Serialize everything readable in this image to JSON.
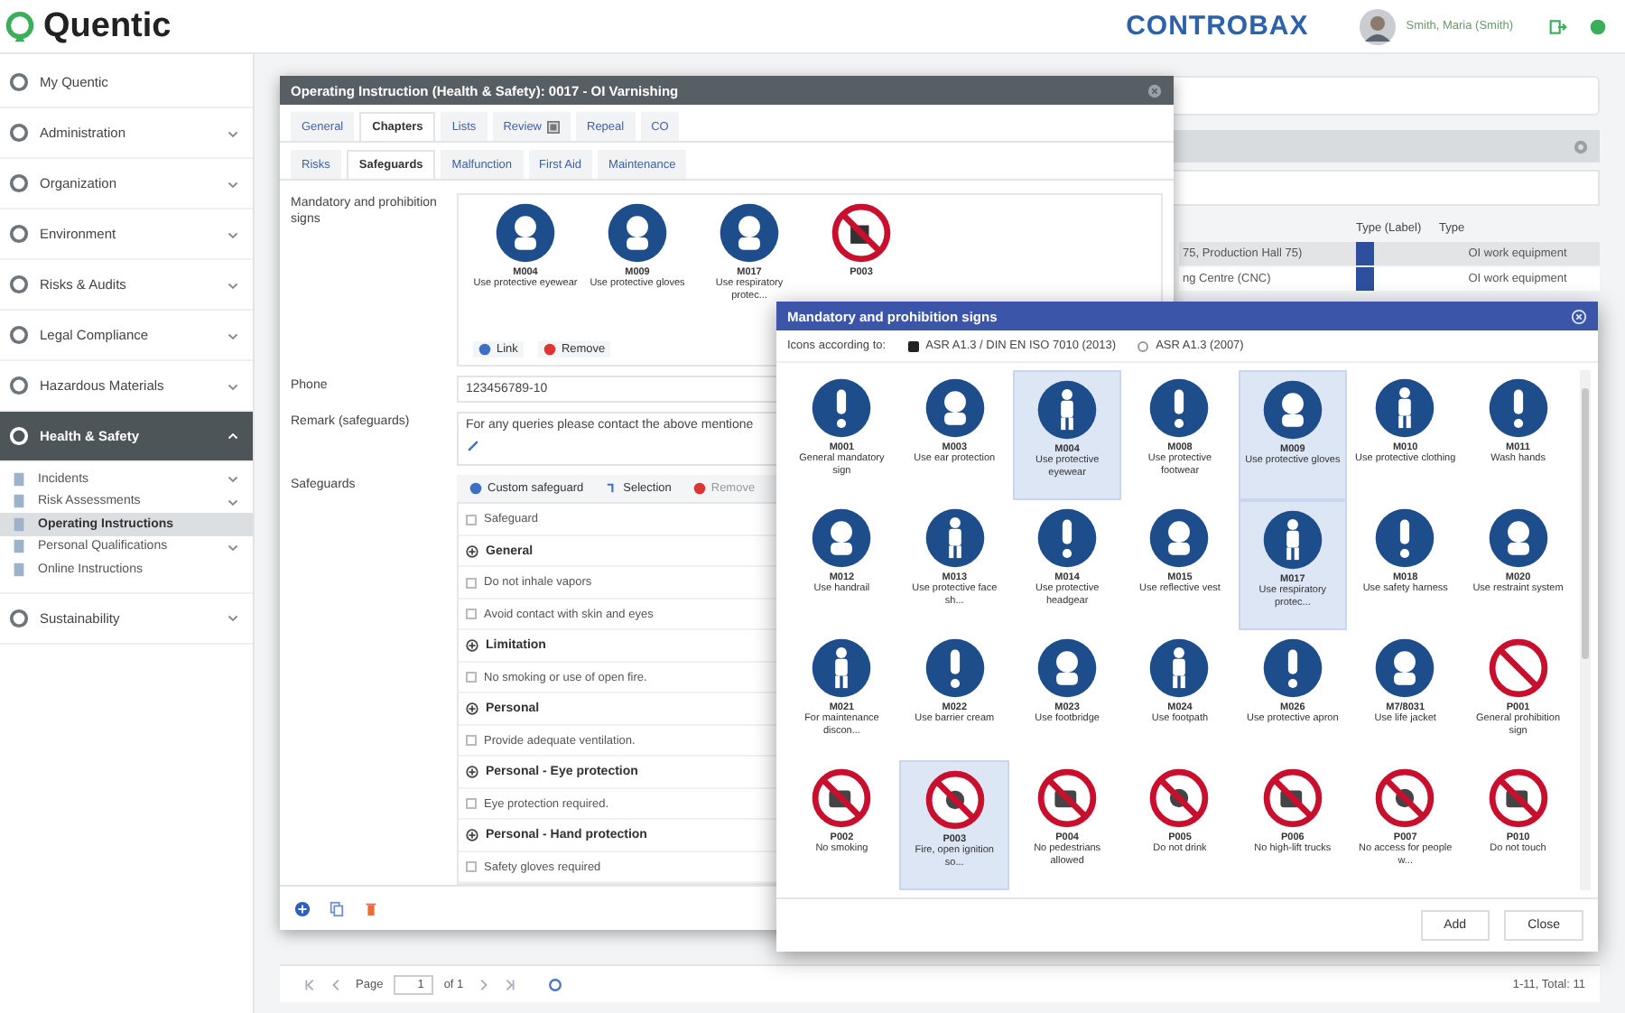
{
  "header": {
    "logo": "Quentic",
    "partner_logo": "CONTROBAX",
    "user": "Smith, Maria (Smith)"
  },
  "sidebar": {
    "items": [
      {
        "label": "My Quentic",
        "selected": false
      },
      {
        "label": "Administration",
        "selected": false,
        "expanded": false
      },
      {
        "label": "Organization",
        "selected": false,
        "expanded": false
      },
      {
        "label": "Environment",
        "selected": false,
        "expanded": false
      },
      {
        "label": "Risks & Audits",
        "selected": false,
        "expanded": false
      },
      {
        "label": "Legal Compliance",
        "selected": false,
        "expanded": false
      },
      {
        "label": "Hazardous Materials",
        "selected": false,
        "expanded": false
      },
      {
        "label": "Health & Safety",
        "selected": true,
        "expanded": true,
        "children": [
          {
            "label": "Incidents",
            "selected": false,
            "expanded": false
          },
          {
            "label": "Risk Assessments",
            "selected": false,
            "expanded": false
          },
          {
            "label": "Operating Instructions",
            "selected": true
          },
          {
            "label": "Personal Qualifications",
            "selected": false,
            "expanded": false
          },
          {
            "label": "Online Instructions",
            "selected": false
          }
        ]
      },
      {
        "label": "Sustainability",
        "selected": false,
        "expanded": false
      }
    ]
  },
  "list_panel": {
    "columns": [
      "Type (Label)",
      "Type"
    ],
    "rows": [
      {
        "location": "75, Production Hall 75)",
        "color": "#2d4f9e",
        "type": "OI work equipment",
        "selected": true
      },
      {
        "location": "ng Centre (CNC)",
        "color": "#2d4f9e",
        "type": "OI work equipment",
        "selected": false
      }
    ],
    "pagination": {
      "page_label": "Page",
      "page": "1",
      "of": "of 1",
      "total": "1-11, Total: 11"
    }
  },
  "instruction_dialog": {
    "title": "Operating Instruction (Health & Safety): 0017 - OI Varnishing",
    "tabs": [
      {
        "label": "General",
        "selected": false
      },
      {
        "label": "Chapters",
        "selected": true
      },
      {
        "label": "Lists",
        "selected": false
      },
      {
        "label": "Review",
        "selected": false,
        "attachment_icon": true
      },
      {
        "label": "Repeal",
        "selected": false
      },
      {
        "label": "CO",
        "selected": false
      }
    ],
    "subtabs": [
      {
        "label": "Risks",
        "selected": false
      },
      {
        "label": "Safeguards",
        "selected": true
      },
      {
        "label": "Malfunction",
        "selected": false
      },
      {
        "label": "First Aid",
        "selected": false
      },
      {
        "label": "Maintenance",
        "selected": false
      }
    ],
    "signs_label": "Mandatory and prohibition signs",
    "signs": [
      {
        "kind": "mandatory",
        "code": "M004",
        "label": "Use protective eyewear"
      },
      {
        "kind": "mandatory",
        "code": "M009",
        "label": "Use protective gloves"
      },
      {
        "kind": "mandatory",
        "code": "M017",
        "label": "Use respiratory protec..."
      },
      {
        "kind": "prohibition",
        "code": "P003"
      }
    ],
    "sign_actions": [
      "Link",
      "Remove"
    ],
    "phone_label": "Phone",
    "phone": "123456789-10",
    "remark_label": "Remark (safeguards)",
    "remark": "For any queries please contact the above mentione",
    "safeguards_label": "Safeguards",
    "safeguard_actions": [
      "Custom safeguard",
      "Selection",
      "Remove"
    ],
    "safeguard_header": "Safeguard",
    "safeguard_header_checked": false,
    "groups": [
      {
        "name": "General",
        "items": [
          {
            "label": "Do not inhale vapors",
            "checked": false
          },
          {
            "label": "Avoid contact with skin and eyes",
            "checked": false
          }
        ]
      },
      {
        "name": "Limitation",
        "items": [
          {
            "label": "No smoking or use of open fire.",
            "checked": false
          }
        ]
      },
      {
        "name": "Personal",
        "items": [
          {
            "label": "Provide adequate ventilation.",
            "checked": false
          }
        ]
      },
      {
        "name": "Personal - Eye protection",
        "items": [
          {
            "label": "Eye protection required.",
            "checked": false
          }
        ]
      },
      {
        "name": "Personal - Hand protection",
        "items": [
          {
            "label": "Safety gloves required",
            "checked": false
          }
        ]
      }
    ]
  },
  "signs_dialog": {
    "title": "Mandatory and prohibition signs",
    "source_label": "Icons according to:",
    "sources": [
      {
        "label": "ASR A1.3 / DIN EN ISO 7010 (2013)",
        "selected": true
      },
      {
        "label": "ASR A1.3 (2007)",
        "selected": false
      }
    ],
    "signs": [
      {
        "kind": "mandatory",
        "code": "M001",
        "label": "General mandatory sign",
        "selected": false
      },
      {
        "kind": "mandatory",
        "code": "M003",
        "label": "Use ear protection",
        "selected": false
      },
      {
        "kind": "mandatory",
        "code": "M004",
        "label": "Use protective eyewear",
        "selected": true
      },
      {
        "kind": "mandatory",
        "code": "M008",
        "label": "Use protective footwear",
        "selected": false
      },
      {
        "kind": "mandatory",
        "code": "M009",
        "label": "Use protective gloves",
        "selected": true
      },
      {
        "kind": "mandatory",
        "code": "M010",
        "label": "Use protective clothing",
        "selected": false
      },
      {
        "kind": "mandatory",
        "code": "M011",
        "label": "Wash hands",
        "selected": false
      },
      {
        "kind": "mandatory",
        "code": "M012",
        "label": "Use handrail",
        "selected": false
      },
      {
        "kind": "mandatory",
        "code": "M013",
        "label": "Use protective face sh...",
        "selected": false
      },
      {
        "kind": "mandatory",
        "code": "M014",
        "label": "Use protective headgear",
        "selected": false
      },
      {
        "kind": "mandatory",
        "code": "M015",
        "label": "Use reflective vest",
        "selected": false
      },
      {
        "kind": "mandatory",
        "code": "M017",
        "label": "Use respiratory protec...",
        "selected": true
      },
      {
        "kind": "mandatory",
        "code": "M018",
        "label": "Use safety harness",
        "selected": false
      },
      {
        "kind": "mandatory",
        "code": "M020",
        "label": "Use restraint system",
        "selected": false
      },
      {
        "kind": "mandatory",
        "code": "M021",
        "label": "For maintenance discon...",
        "selected": false
      },
      {
        "kind": "mandatory",
        "code": "M022",
        "label": "Use barrier cream",
        "selected": false
      },
      {
        "kind": "mandatory",
        "code": "M023",
        "label": "Use footbridge",
        "selected": false
      },
      {
        "kind": "mandatory",
        "code": "M024",
        "label": "Use footpath",
        "selected": false
      },
      {
        "kind": "mandatory",
        "code": "M026",
        "label": "Use protective apron",
        "selected": false
      },
      {
        "kind": "mandatory",
        "code": "M7/8031",
        "label": "Use life jacket",
        "selected": false
      },
      {
        "kind": "prohibition",
        "code": "P001",
        "label": "General prohibition sign",
        "selected": false
      },
      {
        "kind": "prohibition",
        "code": "P002",
        "label": "No smoking",
        "selected": false
      },
      {
        "kind": "prohibition",
        "code": "P003",
        "label": "Fire, open ignition so...",
        "selected": true
      },
      {
        "kind": "prohibition",
        "code": "P004",
        "label": "No pedestrians allowed",
        "selected": false
      },
      {
        "kind": "prohibition",
        "code": "P005",
        "label": "Do not drink",
        "selected": false
      },
      {
        "kind": "prohibition",
        "code": "P006",
        "label": "No high-lift trucks",
        "selected": false
      },
      {
        "kind": "prohibition",
        "code": "P007",
        "label": "No access for people w...",
        "selected": false
      },
      {
        "kind": "prohibition",
        "code": "P010",
        "label": "Do not touch",
        "selected": false
      }
    ],
    "buttons": [
      "Add",
      "Close"
    ]
  }
}
